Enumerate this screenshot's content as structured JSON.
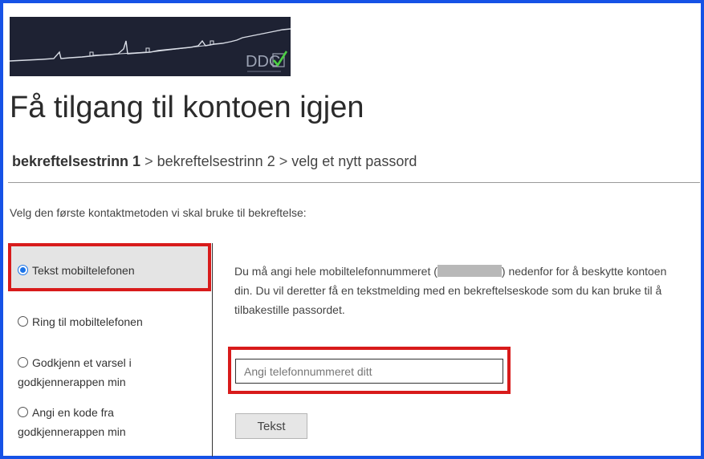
{
  "page": {
    "title": "Få tilgang til kontoen igjen"
  },
  "breadcrumb": {
    "step1": "bekreftelsestrinn 1",
    "separator": ">",
    "step2": "bekreftelsestrinn 2",
    "step3": "velg et nytt passord"
  },
  "instructions": "Velg den første kontaktmetoden vi skal bruke til bekreftelse:",
  "methods": [
    {
      "label": "Tekst mobiltelefonen",
      "selected": true
    },
    {
      "label": "Ring til mobiltelefonen",
      "selected": false
    },
    {
      "label": "Godkjenn et varsel i godkjennerappen min",
      "selected": false
    },
    {
      "label": "Angi en kode fra godkjennerappen min",
      "selected": false
    }
  ],
  "details": {
    "text_before": "Du må angi hele mobiltelefonnummeret (",
    "text_after": ") nedenfor for å beskytte kontoen din. Du vil deretter få en tekstmelding med en bekreftelseskode som du kan bruke til å tilbakestille passordet."
  },
  "phone_input": {
    "placeholder": "Angi telefonnummeret ditt",
    "value": ""
  },
  "send_button": {
    "label": "Tekst"
  },
  "colors": {
    "frame_border": "#1652e6",
    "highlight_border": "#d81b1b",
    "banner_bg": "#1e2233",
    "selected_bg": "#e4e4e4",
    "radio_accent": "#1a73e8"
  },
  "icons": {
    "logo": "ddc-checkmark-logo",
    "radio_selected": "radio-selected-icon",
    "radio_unselected": "radio-unselected-icon"
  }
}
